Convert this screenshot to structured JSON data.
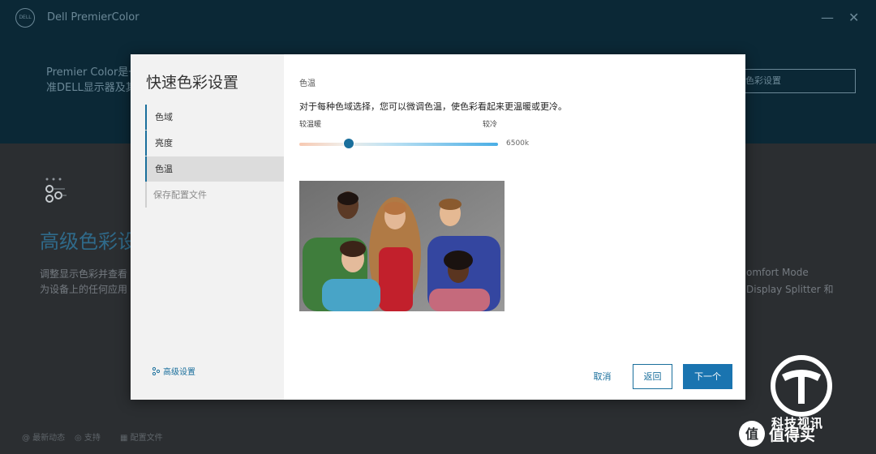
{
  "app": {
    "logo_text": "DELL",
    "title": "Dell PremierColor",
    "minimize": "—",
    "close": "✕"
  },
  "hero": {
    "line1": "Premier Color是一",
    "line2": "准DELL显示器及其",
    "button_label": "色彩设置"
  },
  "advanced": {
    "title": "高级色彩设",
    "desc_line1": "调整显示色彩并查看",
    "desc_line2": "为设备上的任何应用",
    "right_line1": "omfort Mode",
    "right_line2": "Display Splitter 和"
  },
  "footer": {
    "items": [
      "@ 最新动态",
      "◎ 支持",
      "▦ 配置文件"
    ]
  },
  "watermark": {
    "text1": "科技视讯",
    "text2": "值得买"
  },
  "modal": {
    "title": "快速色彩设置",
    "steps": [
      {
        "label": "色域",
        "state": "done"
      },
      {
        "label": "亮度",
        "state": "done"
      },
      {
        "label": "色温",
        "state": "active"
      },
      {
        "label": "保存配置文件",
        "state": "pending"
      }
    ],
    "advanced_link": "高级设置",
    "section_title": "色温",
    "section_desc": "对于每种色域选择，您可以微调色温，使色彩看起来更温暖或更冷。",
    "slider": {
      "label_warm": "较温暖",
      "label_cool": "较冷",
      "value_text": "6500k",
      "position_fraction": 0.25
    },
    "buttons": {
      "cancel": "取消",
      "back": "返回",
      "next": "下一个"
    }
  },
  "colors": {
    "accent": "#1a6f9c",
    "header_bg": "#0b2836",
    "body_bg": "#2b2e31"
  }
}
